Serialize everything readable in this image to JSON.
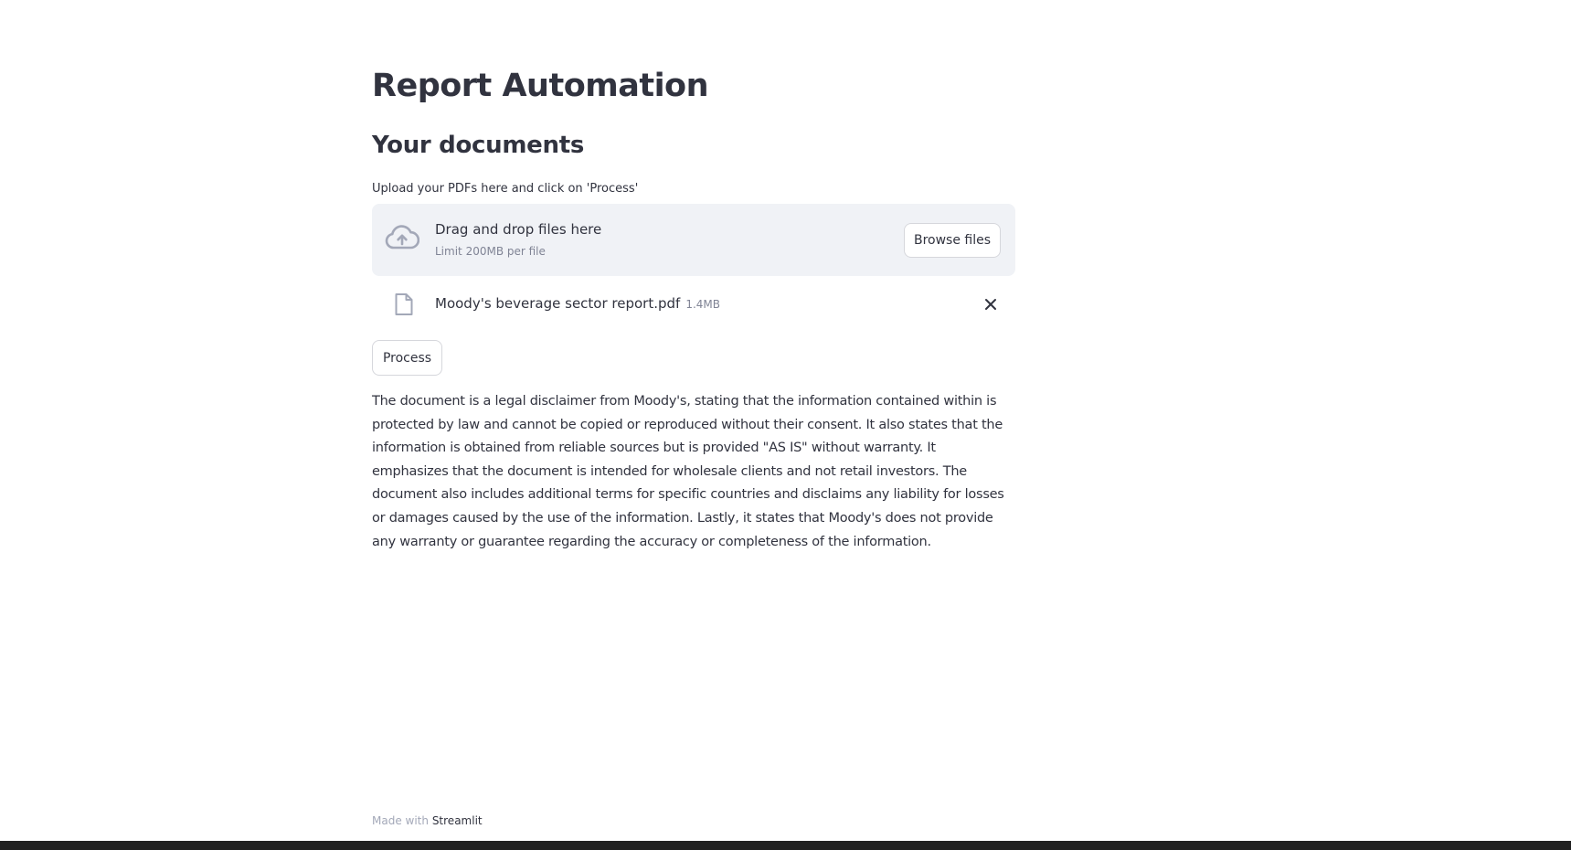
{
  "page": {
    "title": "Report Automation",
    "subheader": "Your documents"
  },
  "uploader": {
    "label": "Upload your PDFs here and click on 'Process'",
    "drop_text": "Drag and drop files here",
    "limit_text": "Limit 200MB per file",
    "browse_label": "Browse files",
    "icon": "cloud-upload-icon"
  },
  "uploaded_file": {
    "name": "Moody's beverage sector report.pdf",
    "size": "1.4MB",
    "icon": "file-icon",
    "remove_icon": "close-icon"
  },
  "process_button": {
    "label": "Process"
  },
  "summary": {
    "text": "The document is a legal disclaimer from Moody's, stating that the information contained within is protected by law and cannot be copied or reproduced without their consent. It also states that the information is obtained from reliable sources but is provided \"AS IS\" without warranty. It emphasizes that the document is intended for wholesale clients and not retail investors. The document also includes additional terms for specific countries and disclaims any liability for losses or damages caused by the use of the information. Lastly, it states that Moody's does not provide any warranty or guarantee regarding the accuracy or completeness of the information."
  },
  "footer": {
    "prefix": "Made with",
    "link": "Streamlit"
  },
  "colors": {
    "text": "#31333f",
    "muted": "#808495",
    "dropzone_bg": "#f0f2f6",
    "border": "#d6d7dc",
    "icon": "#a3a8b8"
  }
}
